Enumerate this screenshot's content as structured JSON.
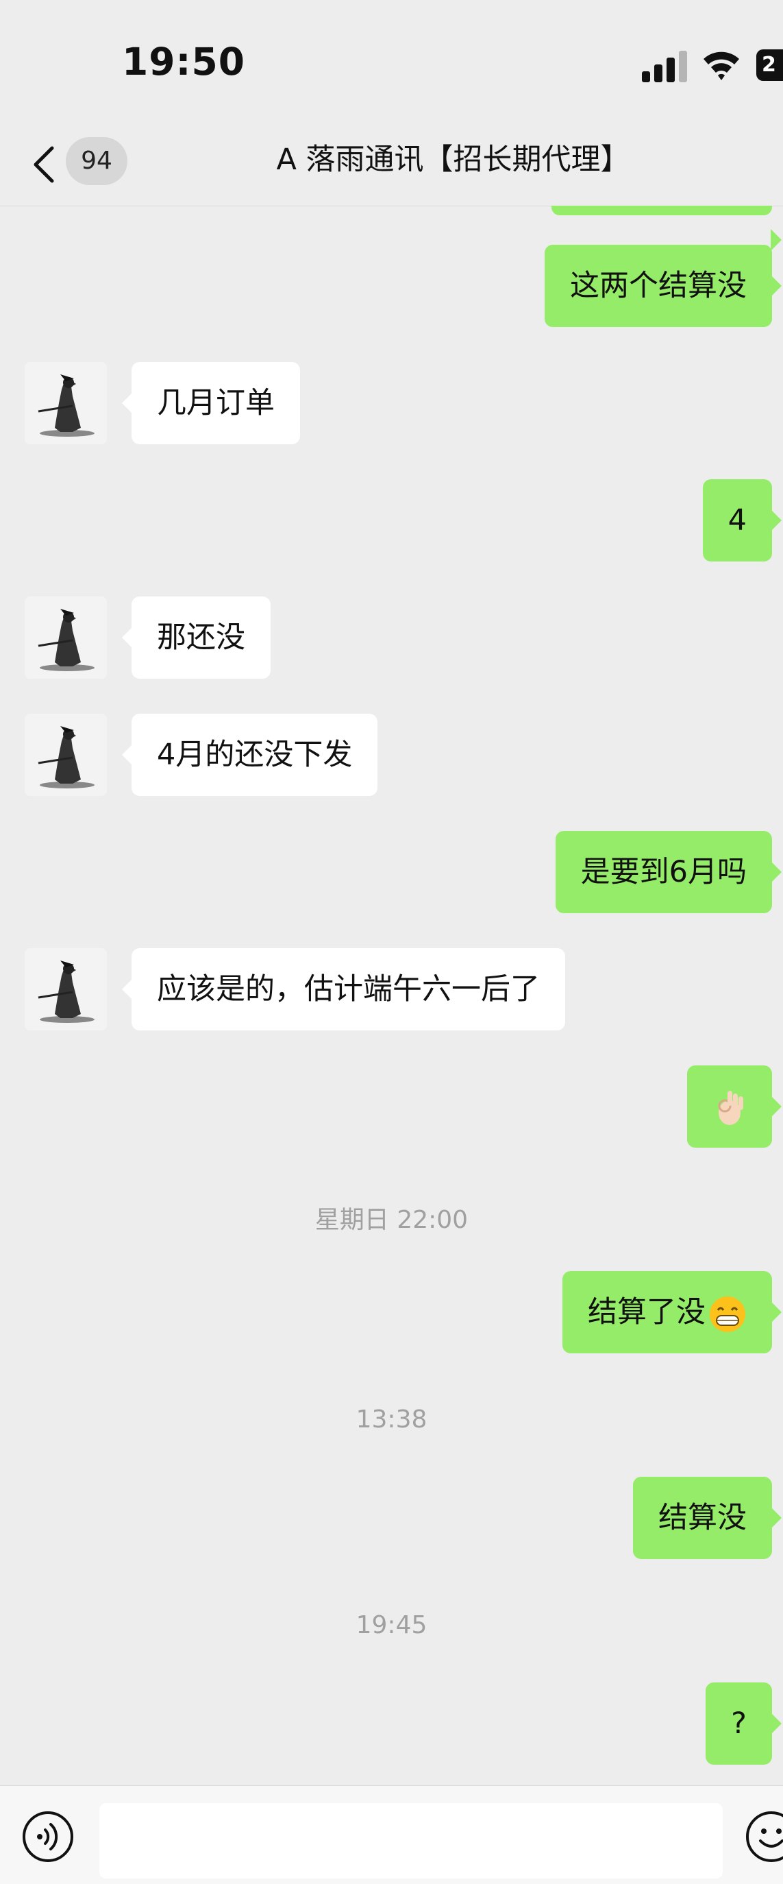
{
  "status_bar": {
    "time": "19:50",
    "battery_text": "2"
  },
  "nav": {
    "unread_count": "94",
    "title": "A 落雨通讯【招长期代理】"
  },
  "messages": [
    {
      "text": "这两个结算没"
    },
    {
      "text": "几月订单"
    },
    {
      "text": "4"
    },
    {
      "text": "那还没"
    },
    {
      "text": "4月的还没下发"
    },
    {
      "text": "是要到6月吗"
    },
    {
      "text": "应该是的，估计端午六一后了"
    },
    {
      "text": "",
      "emoji": "ok-hand-emoji"
    },
    {
      "text": "结算了没",
      "emoji": "grin-emoji"
    },
    {
      "text": "结算没"
    },
    {
      "text": "?"
    }
  ],
  "timestamps": [
    "星期日 22:00",
    "13:38",
    "19:45"
  ],
  "input": {
    "placeholder": ""
  },
  "colors": {
    "background": "#ededed",
    "outgoing_bubble": "#95ec69",
    "incoming_bubble": "#ffffff"
  }
}
